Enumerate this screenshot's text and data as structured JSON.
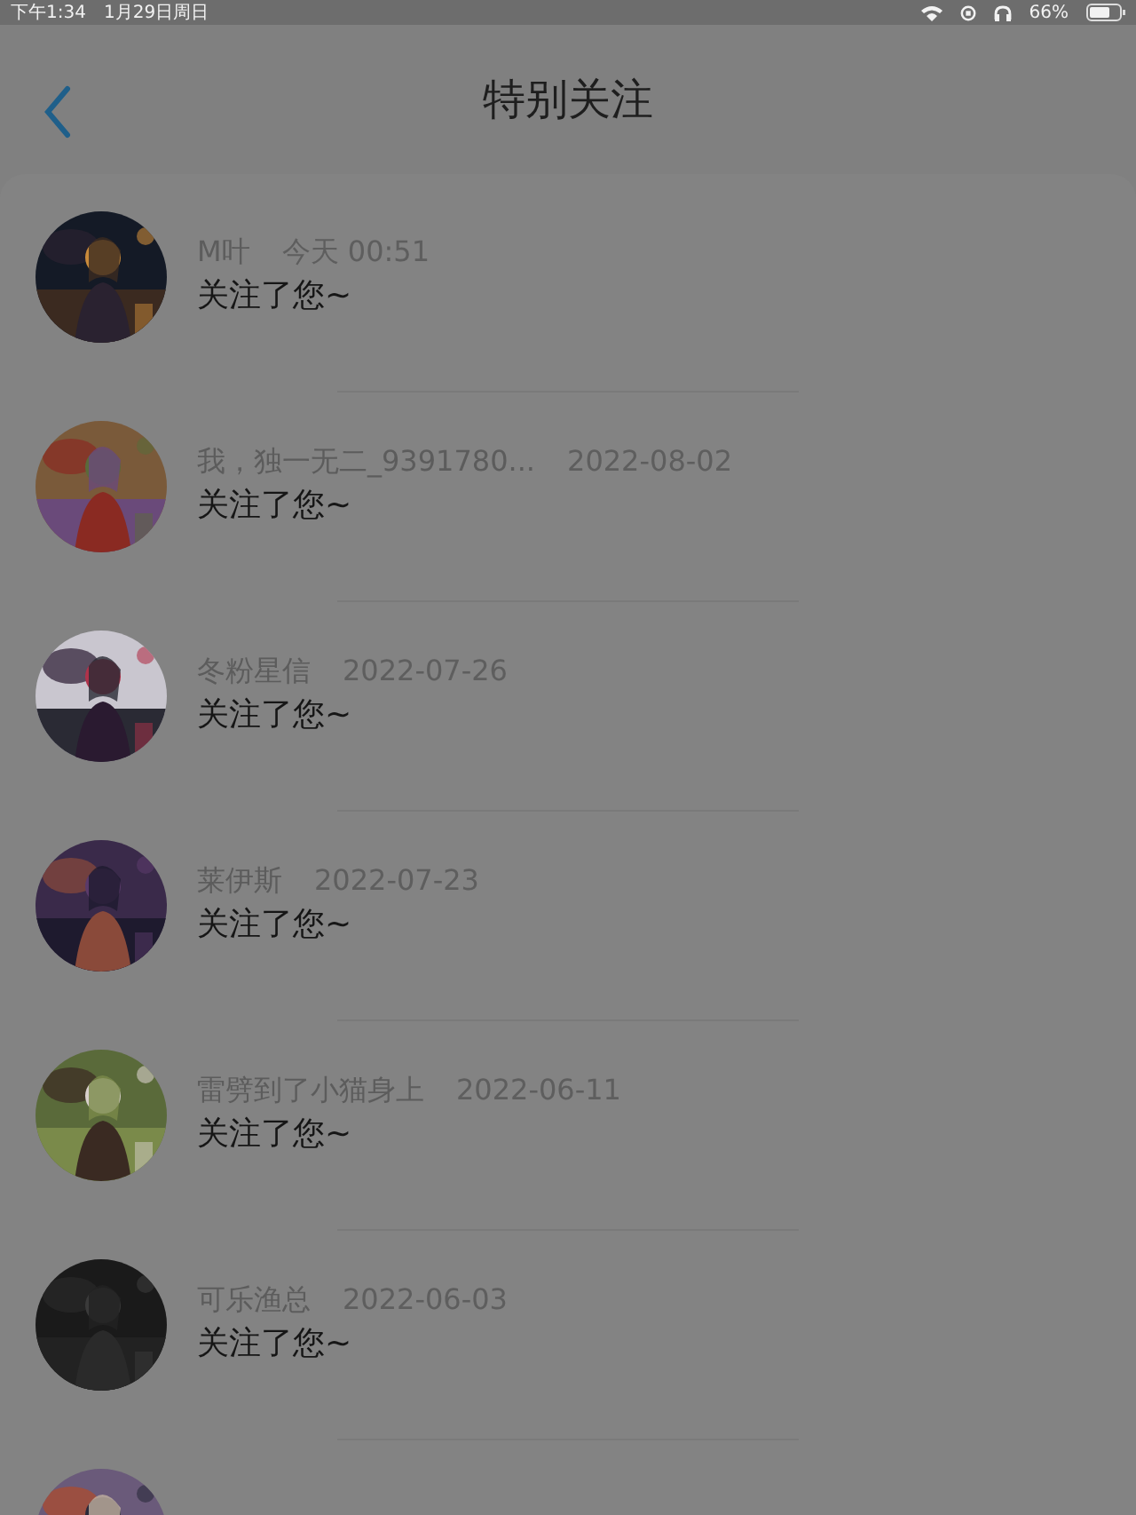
{
  "status_bar": {
    "time": "下午1:34",
    "date": "1月29日周日",
    "battery": "66%"
  },
  "header": {
    "title": "特别关注"
  },
  "notifications": [
    {
      "name": "M叶",
      "time": "今天 00:51",
      "message": "关注了您~",
      "avatar": {
        "kind": "picture"
      }
    },
    {
      "name": "我，独一无二_9391780...",
      "time": "2022-08-02",
      "message": "关注了您~",
      "avatar": {
        "kind": "picture"
      }
    },
    {
      "name": "冬粉星信",
      "time": "2022-07-26",
      "message": "关注了您~",
      "avatar": {
        "kind": "picture"
      }
    },
    {
      "name": "莱伊斯",
      "time": "2022-07-23",
      "message": "关注了您~",
      "avatar": {
        "kind": "picture"
      }
    },
    {
      "name": "雷劈到了小猫身上",
      "time": "2022-06-11",
      "message": "关注了您~",
      "avatar": {
        "kind": "picture"
      }
    },
    {
      "name": "可乐渔总",
      "time": "2022-06-03",
      "message": "关注了您~",
      "avatar": {
        "kind": "picture"
      }
    },
    {
      "avatar": {
        "kind": "picture"
      }
    }
  ]
}
